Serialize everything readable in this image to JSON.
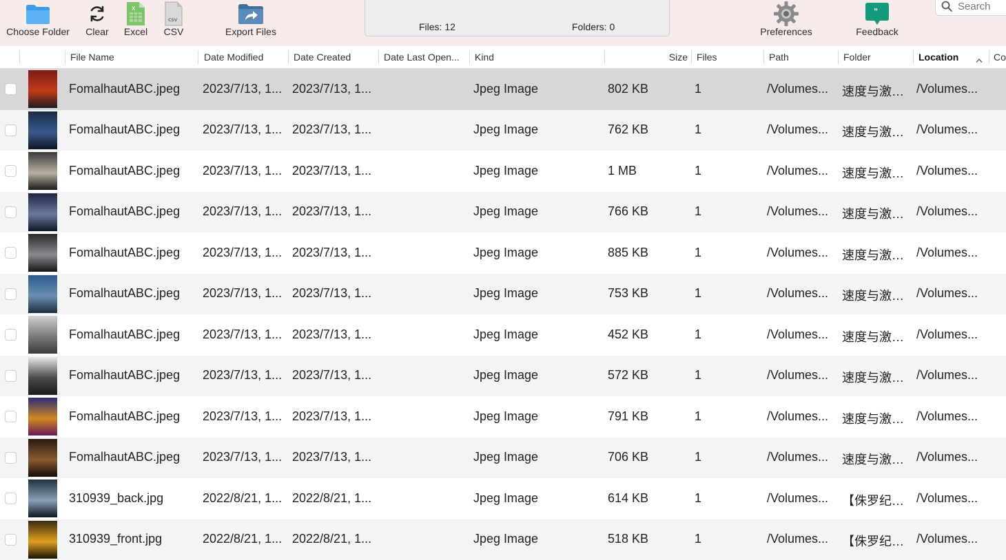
{
  "toolbar": {
    "choose_folder": "Choose Folder",
    "clear": "Clear",
    "excel": "Excel",
    "csv": "CSV",
    "csv_icon_text": "csv",
    "excel_icon_text": "X",
    "export": "Export Files",
    "preferences": "Preferences",
    "feedback": "Feedback",
    "search_placeholder": "Search"
  },
  "stats": {
    "files": "Files: 12",
    "folders": "Folders: 0"
  },
  "columns": {
    "file_name": "File Name",
    "date_modified": "Date Modified",
    "date_created": "Date Created",
    "date_last_opened": "Date Last Open...",
    "kind": "Kind",
    "size": "Size",
    "files": "Files",
    "path": "Path",
    "folder": "Folder",
    "location": "Location",
    "comments": "Co"
  },
  "rows": [
    {
      "name": "FomalhautABC.jpeg",
      "modified": "2023/7/13, 1...",
      "created": "2023/7/13, 1...",
      "opened": "",
      "kind": "Jpeg Image",
      "size": "802 KB",
      "files": "1",
      "path": "/Volumes...",
      "folder": "速度与激…",
      "location": "/Volumes...",
      "thumb": [
        "#7a1d14",
        "#c23a1a",
        "#1c1c1c"
      ],
      "selected": true
    },
    {
      "name": "FomalhautABC.jpeg",
      "modified": "2023/7/13, 1...",
      "created": "2023/7/13, 1...",
      "opened": "",
      "kind": "Jpeg Image",
      "size": "762 KB",
      "files": "1",
      "path": "/Volumes...",
      "folder": "速度与激…",
      "location": "/Volumes...",
      "thumb": [
        "#1a2a4a",
        "#3a5a8a",
        "#0e1424"
      ],
      "selected": false
    },
    {
      "name": "FomalhautABC.jpeg",
      "modified": "2023/7/13, 1...",
      "created": "2023/7/13, 1...",
      "opened": "",
      "kind": "Jpeg Image",
      "size": "1 MB",
      "files": "1",
      "path": "/Volumes...",
      "folder": "速度与激…",
      "location": "/Volumes...",
      "thumb": [
        "#3a3a3a",
        "#b8b0a0",
        "#1a1a1a"
      ],
      "selected": false
    },
    {
      "name": "FomalhautABC.jpeg",
      "modified": "2023/7/13, 1...",
      "created": "2023/7/13, 1...",
      "opened": "",
      "kind": "Jpeg Image",
      "size": "766 KB",
      "files": "1",
      "path": "/Volumes...",
      "folder": "速度与激…",
      "location": "/Volumes...",
      "thumb": [
        "#1d2440",
        "#6a7aa0",
        "#111522"
      ],
      "selected": false
    },
    {
      "name": "FomalhautABC.jpeg",
      "modified": "2023/7/13, 1...",
      "created": "2023/7/13, 1...",
      "opened": "",
      "kind": "Jpeg Image",
      "size": "885 KB",
      "files": "1",
      "path": "/Volumes...",
      "folder": "速度与激…",
      "location": "/Volumes...",
      "thumb": [
        "#2a2a2a",
        "#8a8a90",
        "#151515"
      ],
      "selected": false
    },
    {
      "name": "FomalhautABC.jpeg",
      "modified": "2023/7/13, 1...",
      "created": "2023/7/13, 1...",
      "opened": "",
      "kind": "Jpeg Image",
      "size": "753 KB",
      "files": "1",
      "path": "/Volumes...",
      "folder": "速度与激…",
      "location": "/Volumes...",
      "thumb": [
        "#2d5a8a",
        "#6b8fb0",
        "#1a2c40"
      ],
      "selected": false
    },
    {
      "name": "FomalhautABC.jpeg",
      "modified": "2023/7/13, 1...",
      "created": "2023/7/13, 1...",
      "opened": "",
      "kind": "Jpeg Image",
      "size": "452 KB",
      "files": "1",
      "path": "/Volumes...",
      "folder": "速度与激…",
      "location": "/Volumes...",
      "thumb": [
        "#cfcfcf",
        "#7a7a7a",
        "#3a3a3a"
      ],
      "selected": false
    },
    {
      "name": "FomalhautABC.jpeg",
      "modified": "2023/7/13, 1...",
      "created": "2023/7/13, 1...",
      "opened": "",
      "kind": "Jpeg Image",
      "size": "572 KB",
      "files": "1",
      "path": "/Volumes...",
      "folder": "速度与激…",
      "location": "/Volumes...",
      "thumb": [
        "#e8e8e8",
        "#4a4a4a",
        "#1a1a1a"
      ],
      "selected": false
    },
    {
      "name": "FomalhautABC.jpeg",
      "modified": "2023/7/13, 1...",
      "created": "2023/7/13, 1...",
      "opened": "",
      "kind": "Jpeg Image",
      "size": "791 KB",
      "files": "1",
      "path": "/Volumes...",
      "folder": "速度与激…",
      "location": "/Volumes...",
      "thumb": [
        "#2a2a7a",
        "#d08a20",
        "#6a1a5a"
      ],
      "selected": false
    },
    {
      "name": "FomalhautABC.jpeg",
      "modified": "2023/7/13, 1...",
      "created": "2023/7/13, 1...",
      "opened": "",
      "kind": "Jpeg Image",
      "size": "706 KB",
      "files": "1",
      "path": "/Volumes...",
      "folder": "速度与激…",
      "location": "/Volumes...",
      "thumb": [
        "#2a1a10",
        "#8a5a30",
        "#140c08"
      ],
      "selected": false
    },
    {
      "name": "310939_back.jpg",
      "modified": "2022/8/21, 1...",
      "created": "2022/8/21, 1...",
      "opened": "",
      "kind": "Jpeg Image",
      "size": "614 KB",
      "files": "1",
      "path": "/Volumes...",
      "folder": "【侏罗纪…",
      "location": "/Volumes...",
      "thumb": [
        "#203040",
        "#8aa0b8",
        "#0e1620"
      ],
      "selected": false
    },
    {
      "name": "310939_front.jpg",
      "modified": "2022/8/21, 1...",
      "created": "2022/8/21, 1...",
      "opened": "",
      "kind": "Jpeg Image",
      "size": "518 KB",
      "files": "1",
      "path": "/Volumes...",
      "folder": "【侏罗纪…",
      "location": "/Volumes...",
      "thumb": [
        "#3a2a10",
        "#e0a020",
        "#1a1208"
      ],
      "selected": false
    }
  ]
}
